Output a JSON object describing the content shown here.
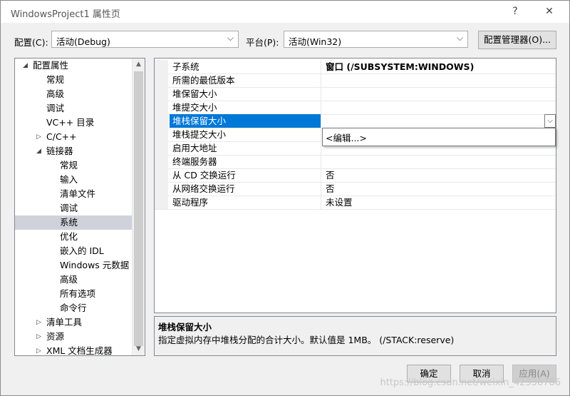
{
  "window": {
    "title": "WindowsProject1 属性页",
    "help": "?",
    "close": "✕"
  },
  "config": {
    "label": "配置(C):",
    "value": "活动(Debug)"
  },
  "platform": {
    "label": "平台(P):",
    "value": "活动(Win32)"
  },
  "config_manager_btn": "配置管理器(O)...",
  "tree": [
    {
      "label": "配置属性",
      "exp": "◢"
    },
    {
      "label": "常规"
    },
    {
      "label": "高级"
    },
    {
      "label": "调试"
    },
    {
      "label": "VC++ 目录"
    },
    {
      "label": "C/C++",
      "exp": "▷"
    },
    {
      "label": "链接器",
      "exp": "◢"
    },
    {
      "label": "常规"
    },
    {
      "label": "输入"
    },
    {
      "label": "清单文件"
    },
    {
      "label": "调试"
    },
    {
      "label": "系统"
    },
    {
      "label": "优化"
    },
    {
      "label": "嵌入的 IDL"
    },
    {
      "label": "Windows 元数据"
    },
    {
      "label": "高级"
    },
    {
      "label": "所有选项"
    },
    {
      "label": "命令行"
    },
    {
      "label": "清单工具",
      "exp": "▷"
    },
    {
      "label": "资源",
      "exp": "▷"
    },
    {
      "label": "XML 文档生成器",
      "exp": "▷"
    }
  ],
  "grid": [
    {
      "name": "子系统",
      "value": "窗口 (/SUBSYSTEM:WINDOWS)"
    },
    {
      "name": "所需的最低版本",
      "value": ""
    },
    {
      "name": "堆保留大小",
      "value": ""
    },
    {
      "name": "堆提交大小",
      "value": ""
    },
    {
      "name": "堆栈保留大小",
      "value": ""
    },
    {
      "name": "堆栈提交大小",
      "value": ""
    },
    {
      "name": "启用大地址",
      "value": ""
    },
    {
      "name": "终端服务器",
      "value": ""
    },
    {
      "name": "从 CD 交换运行",
      "value": "否"
    },
    {
      "name": "从网络交换运行",
      "value": "否"
    },
    {
      "name": "驱动程序",
      "value": "未设置"
    }
  ],
  "dropdown_option": "<编辑...>",
  "description": {
    "heading": "堆栈保留大小",
    "text": "指定虚拟内存中堆栈分配的合计大小。默认值是 1MB。     (/STACK:reserve)"
  },
  "buttons": {
    "ok": "确定",
    "cancel": "取消",
    "apply": "应用(A)"
  },
  "watermark": "https://blog.csdn.net/weixin_42336786",
  "colors": {
    "selection": "#0078d7",
    "tree_selection": "#cfd2db"
  }
}
